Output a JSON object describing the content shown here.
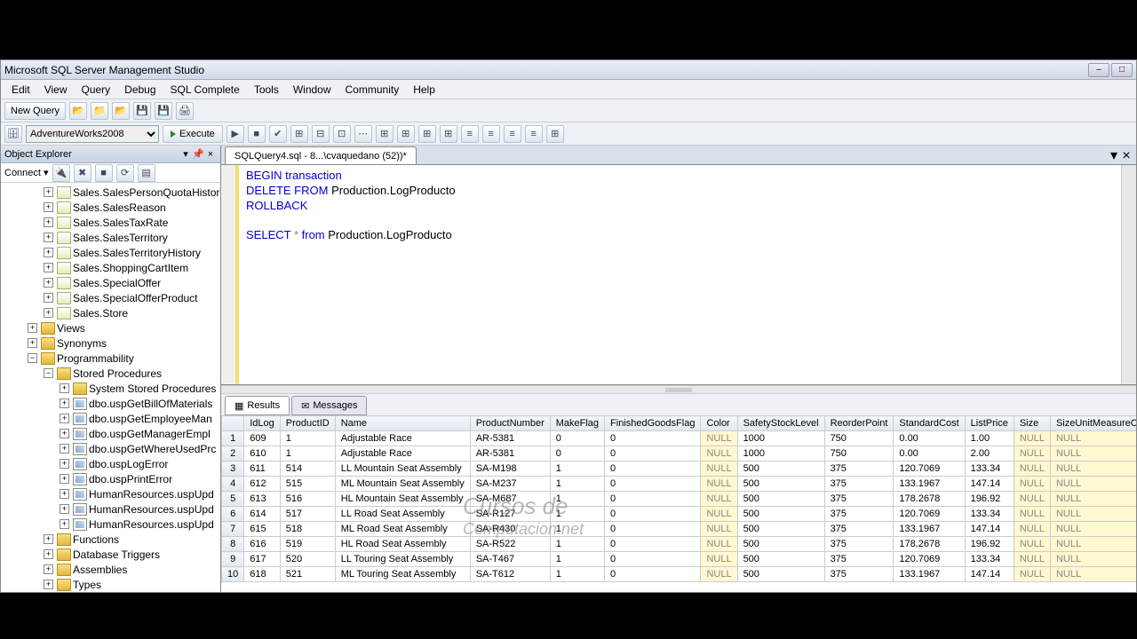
{
  "window": {
    "title": "Microsoft SQL Server Management Studio"
  },
  "menu": [
    "Edit",
    "View",
    "Query",
    "Debug",
    "SQL Complete",
    "Tools",
    "Window",
    "Community",
    "Help"
  ],
  "toolbar": {
    "newquery": "New Query"
  },
  "toolbar2": {
    "db": "AdventureWorks2008",
    "execute": "Execute"
  },
  "sidebar": {
    "header": "Object Explorer",
    "connect": "Connect ▾",
    "tree": {
      "tables": [
        "Sales.SalesPersonQuotaHistor",
        "Sales.SalesReason",
        "Sales.SalesTaxRate",
        "Sales.SalesTerritory",
        "Sales.SalesTerritoryHistory",
        "Sales.ShoppingCartItem",
        "Sales.SpecialOffer",
        "Sales.SpecialOfferProduct",
        "Sales.Store"
      ],
      "folders1": [
        "Views",
        "Synonyms"
      ],
      "prog": "Programmability",
      "sp": "Stored Procedures",
      "spitems": [
        "System Stored Procedures",
        "dbo.uspGetBillOfMaterials",
        "dbo.uspGetEmployeeMan",
        "dbo.uspGetManagerEmpl",
        "dbo.uspGetWhereUsedPrc",
        "dbo.uspLogError",
        "dbo.uspPrintError",
        "HumanResources.uspUpd",
        "HumanResources.uspUpd",
        "HumanResources.uspUpd"
      ],
      "folders2": [
        "Functions",
        "Database Triggers",
        "Assemblies",
        "Types"
      ]
    }
  },
  "tab": {
    "label": "SQLQuery4.sql - 8...\\cvaquedano (52))*"
  },
  "sql": {
    "l1a": "BEGIN",
    "l1b": " transaction",
    "l2a": "DELETE FROM",
    "l2b": " Production.LogProducto",
    "l3": "ROLLBACK",
    "l5a": "SELECT",
    "l5b": " * ",
    "l5c": "from",
    "l5d": " Production.LogProducto"
  },
  "restabs": {
    "results": "Results",
    "messages": "Messages"
  },
  "grid": {
    "cols": [
      "IdLog",
      "ProductID",
      "Name",
      "ProductNumber",
      "MakeFlag",
      "FinishedGoodsFlag",
      "Color",
      "SafetyStockLevel",
      "ReorderPoint",
      "StandardCost",
      "ListPrice",
      "Size",
      "SizeUnitMeasureCode"
    ],
    "rows": [
      {
        "n": "1",
        "c": [
          "609",
          "1",
          "Adjustable Race",
          "AR-5381",
          "0",
          "0",
          "NULL",
          "1000",
          "750",
          "0.00",
          "1.00",
          "NULL",
          "NULL"
        ]
      },
      {
        "n": "2",
        "c": [
          "610",
          "1",
          "Adjustable Race",
          "AR-5381",
          "0",
          "0",
          "NULL",
          "1000",
          "750",
          "0.00",
          "2.00",
          "NULL",
          "NULL"
        ]
      },
      {
        "n": "3",
        "c": [
          "611",
          "514",
          "LL Mountain Seat Assembly",
          "SA-M198",
          "1",
          "0",
          "NULL",
          "500",
          "375",
          "120.7069",
          "133.34",
          "NULL",
          "NULL"
        ]
      },
      {
        "n": "4",
        "c": [
          "612",
          "515",
          "ML Mountain Seat Assembly",
          "SA-M237",
          "1",
          "0",
          "NULL",
          "500",
          "375",
          "133.1967",
          "147.14",
          "NULL",
          "NULL"
        ]
      },
      {
        "n": "5",
        "c": [
          "613",
          "516",
          "HL Mountain Seat Assembly",
          "SA-M687",
          "1",
          "0",
          "NULL",
          "500",
          "375",
          "178.2678",
          "196.92",
          "NULL",
          "NULL"
        ]
      },
      {
        "n": "6",
        "c": [
          "614",
          "517",
          "LL Road Seat Assembly",
          "SA-R127",
          "1",
          "0",
          "NULL",
          "500",
          "375",
          "120.7069",
          "133.34",
          "NULL",
          "NULL"
        ]
      },
      {
        "n": "7",
        "c": [
          "615",
          "518",
          "ML Road Seat Assembly",
          "SA-R430",
          "1",
          "0",
          "NULL",
          "500",
          "375",
          "133.1967",
          "147.14",
          "NULL",
          "NULL"
        ]
      },
      {
        "n": "8",
        "c": [
          "616",
          "519",
          "HL Road Seat Assembly",
          "SA-R522",
          "1",
          "0",
          "NULL",
          "500",
          "375",
          "178.2678",
          "196.92",
          "NULL",
          "NULL"
        ]
      },
      {
        "n": "9",
        "c": [
          "617",
          "520",
          "LL Touring Seat Assembly",
          "SA-T467",
          "1",
          "0",
          "NULL",
          "500",
          "375",
          "120.7069",
          "133.34",
          "NULL",
          "NULL"
        ]
      },
      {
        "n": "10",
        "c": [
          "618",
          "521",
          "ML Touring Seat Assembly",
          "SA-T612",
          "1",
          "0",
          "NULL",
          "500",
          "375",
          "133.1967",
          "147.14",
          "NULL",
          "NULL"
        ]
      }
    ]
  },
  "watermark": {
    "l1": "Cursos de",
    "l2": "Computacion.net"
  }
}
